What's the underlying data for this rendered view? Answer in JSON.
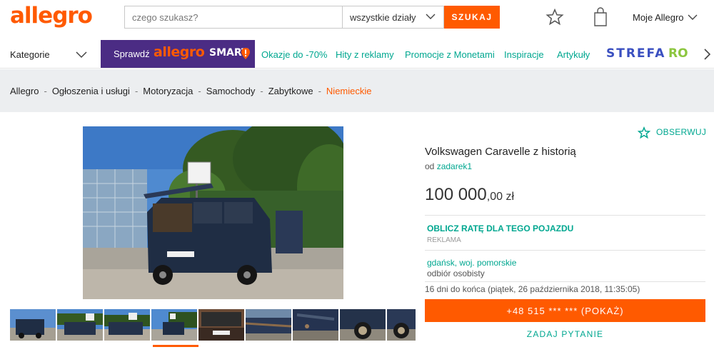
{
  "header": {
    "logo": "allegro",
    "search_placeholder": "czego szukasz?",
    "department": "wszystkie działy",
    "search_button": "SZUKAJ",
    "account": "Moje Allegro"
  },
  "nav": {
    "categories": "Kategorie",
    "smart_prefix": "Sprawdź",
    "smart_logo": "allegro",
    "smart_word": "SMART",
    "links": [
      "Okazje do -70%",
      "Hity z reklamy",
      "Promocje z Monetami",
      "Inspiracje",
      "Artykuły"
    ],
    "strefa": "STREFA",
    "strefa_cut": "RO"
  },
  "breadcrumb": [
    "Allegro",
    "Ogłoszenia i usługi",
    "Motoryzacja",
    "Samochody",
    "Zabytkowe",
    "Niemieckie"
  ],
  "gallery": {
    "thumbnail_count": 9,
    "active_thumbnail": 4
  },
  "offer": {
    "watch": "OBSERWUJ",
    "title": "Volkswagen Caravelle z historią",
    "seller_prefix": "od",
    "seller": "zadarek1",
    "price_main": "100 000",
    "price_fraction": ",00 zł",
    "calc_link": "OBLICZ RATĘ DLA TEGO POJAZDU",
    "ad_label": "REKLAMA",
    "location": "gdańsk, woj. pomorskie",
    "pickup": "odbiór osobisty",
    "ends": "16 dni do końca (piątek, 26 października 2018, 11:35:05)",
    "phone_button": "+48 515 *** *** (POKAŻ)",
    "ask_button": "ZADAJ PYTANIE"
  },
  "colors": {
    "brand": "#ff5a00",
    "link": "#00a790",
    "smart_bg": "#4b2c84"
  }
}
